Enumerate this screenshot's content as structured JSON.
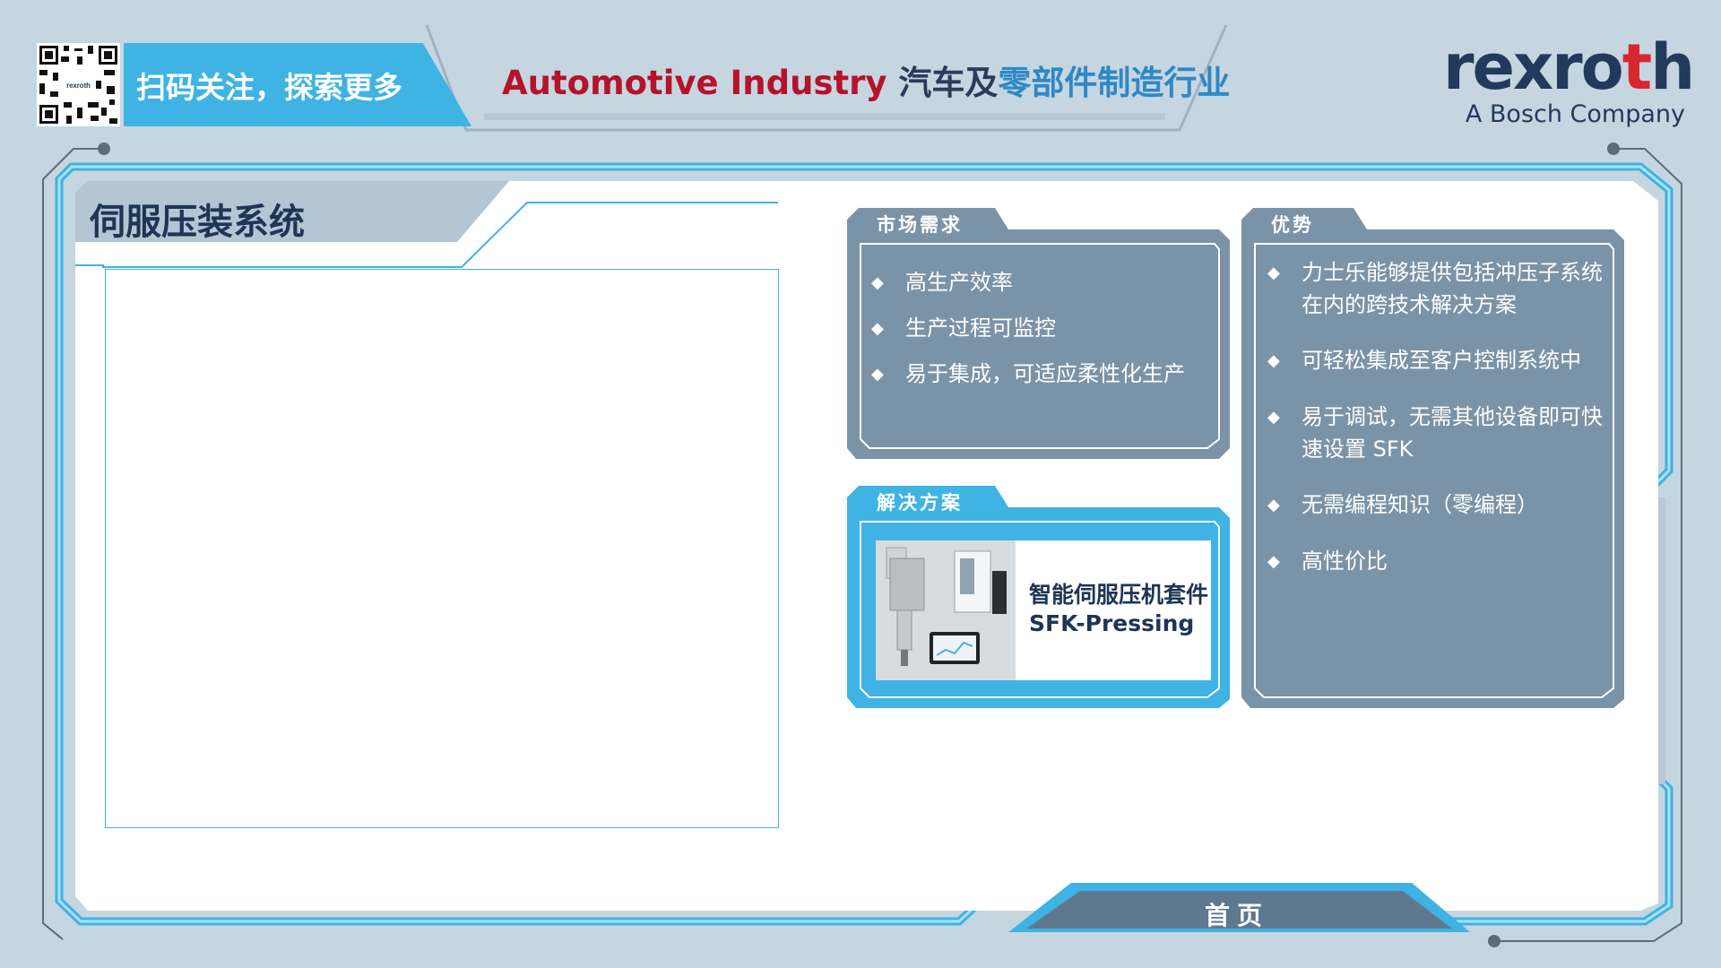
{
  "header": {
    "qr_caption": "扫码关注，探索更多",
    "title_en": "Automotive Industry",
    "title_cn_a": "汽车及",
    "title_cn_b": "零部件制造行业"
  },
  "brand": {
    "name_a": "rexro",
    "name_b": "t",
    "name_c": "h",
    "tagline": "A Bosch Company",
    "qr_mini_label": "rexroth"
  },
  "section": {
    "title": "伺服压装系统"
  },
  "market": {
    "label": "市场需求",
    "items": [
      "高生产效率",
      "生产过程可监控",
      "易于集成，可适应柔性化生产"
    ]
  },
  "solution": {
    "label": "解决方案",
    "product_line1": "智能伺服压机套件",
    "product_line2": "SFK-Pressing"
  },
  "advantages": {
    "label": "优势",
    "items": [
      "力士乐能够提供包括冲压子系统在内的跨技术解决方案",
      "可轻松集成至客户控制系统中",
      "易于调试，无需其他设备即可快速设置 SFK",
      "无需编程知识（零编程）",
      "高性价比"
    ]
  },
  "nav": {
    "home": "首页"
  },
  "icons": {
    "bullet": "diamond-icon"
  },
  "colors": {
    "accent_blue": "#3fb3e3",
    "card_gray": "#7b93a7",
    "brand_navy": "#233a5d",
    "brand_red": "#d8262f",
    "title_red": "#b5122b"
  }
}
